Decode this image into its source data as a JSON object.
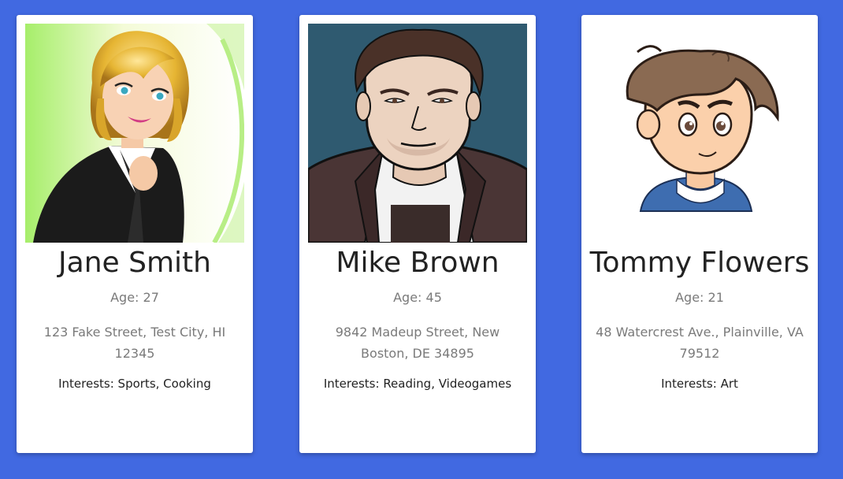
{
  "people": [
    {
      "name": "Jane Smith",
      "age": "Age: 27",
      "address": "123 Fake Street, Test City, HI 12345",
      "interests_label": "Interests: ",
      "interests": "Sports, Cooking",
      "avatar_icon": "woman-avatar-icon"
    },
    {
      "name": "Mike Brown",
      "age": "Age: 45",
      "address": "9842 Madeup Street, New Boston, DE 34895",
      "interests_label": "Interests: ",
      "interests": "Reading, Videogames",
      "avatar_icon": "man-avatar-icon"
    },
    {
      "name": "Tommy Flowers",
      "age": "Age: 21",
      "address": "48 Watercrest Ave., Plainville, VA 79512",
      "interests_label": "Interests: ",
      "interests": "Art",
      "avatar_icon": "boy-avatar-icon"
    }
  ],
  "colors": {
    "background": "#4169e1",
    "card": "#ffffff",
    "name_text": "#222222",
    "muted_text": "#7a7a7a"
  }
}
